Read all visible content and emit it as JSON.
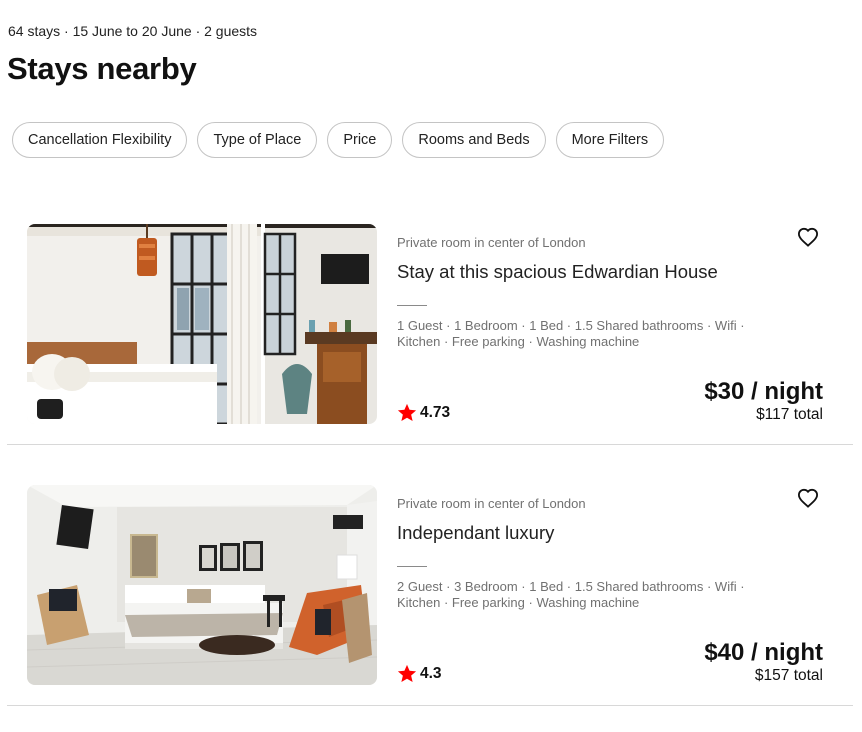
{
  "search": {
    "summary": "64 stays · 15 June to 20 June · 2 guests",
    "heading": "Stays nearby"
  },
  "filters": [
    {
      "label": "Cancellation Flexibility"
    },
    {
      "label": "Type of Place"
    },
    {
      "label": "Price"
    },
    {
      "label": "Rooms and Beds"
    },
    {
      "label": "More Filters"
    }
  ],
  "listings": [
    {
      "subtitle": "Private room in center of London",
      "title": "Stay at this spacious Edwardian House",
      "amenities_line1": "1 Guest · 1 Bedroom · 1 Bed · 1.5 Shared bathrooms · Wifi ·",
      "amenities_line2": "Kitchen · Free parking · Washing machine",
      "rating": "4.73",
      "price_per_night": "$30 / night",
      "price_total": "$117 total",
      "favorite_icon": "heart-outline-icon"
    },
    {
      "subtitle": "Private room in center of London",
      "title": "Independant luxury",
      "amenities_line1": "2 Guest · 3 Bedroom · 1 Bed · 1.5 Shared bathrooms · Wifi ·",
      "amenities_line2": "Kitchen · Free parking · Washing machine",
      "rating": "4.3",
      "price_per_night": "$40 / night",
      "price_total": "$157 total",
      "favorite_icon": "heart-outline-icon"
    }
  ],
  "colors": {
    "star": "#ff0000",
    "muted_text": "#717171",
    "pill_border": "#c4c4c4",
    "divider": "#d8d8d8"
  }
}
